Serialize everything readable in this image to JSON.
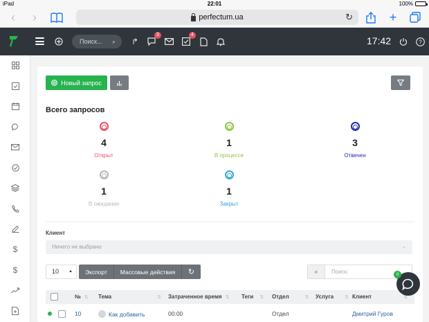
{
  "status_bar": {
    "device": "iPad",
    "time": "22:01",
    "battery": "100%",
    "battery_level": 1.0
  },
  "browser": {
    "url": "perfectum.ua"
  },
  "header": {
    "search_placeholder": "Поиск...",
    "messages_badge": "3",
    "tasks_badge": "4",
    "time": "17:42"
  },
  "toolbar": {
    "new_request_label": "Новый запрос"
  },
  "summary": {
    "title": "Всего запросов",
    "stats": [
      {
        "count": "4",
        "label": "Открыт",
        "color": "#e8535f"
      },
      {
        "count": "1",
        "label": "В процессе",
        "color": "#8cc63f"
      },
      {
        "count": "3",
        "label": "Отвечен",
        "color": "#1f2fb0"
      },
      {
        "count": "1",
        "label": "В ожидании",
        "color": "#b5b9bc"
      },
      {
        "count": "1",
        "label": "Закрыт",
        "color": "#2ea7d8"
      }
    ]
  },
  "filter": {
    "client_label": "Клиент",
    "client_placeholder": "Ничего не выбрано"
  },
  "controls": {
    "per_page": "10",
    "export_label": "Экспорт",
    "bulk_label": "Массовые действия",
    "search_placeholder": "Поиск:"
  },
  "table": {
    "columns": [
      "№",
      "Тема",
      "Затраченное время",
      "Теги",
      "Отдел",
      "Услуга",
      "Клиент"
    ],
    "rows": [
      {
        "id": "10",
        "subject": "Как добавить",
        "time_spent": "00:00",
        "tags": "",
        "department": "Отдел",
        "service": "",
        "client": "Дмитрий Гуров"
      }
    ]
  },
  "chat": {
    "badge": "0"
  },
  "colors": {
    "accent_green": "#27b34f",
    "header_bg": "#2f353b",
    "link": "#2c5fa5"
  }
}
